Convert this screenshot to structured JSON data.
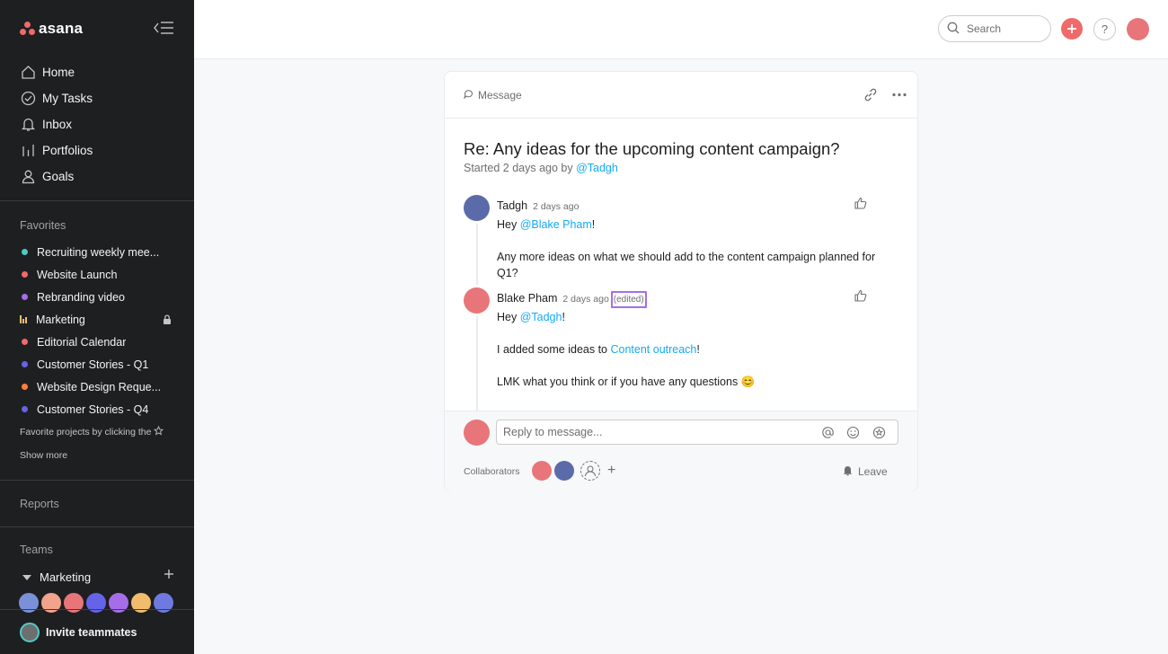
{
  "sidebar": {
    "logo_text": "asana",
    "nav": [
      {
        "label": "Home",
        "icon": "home-icon"
      },
      {
        "label": "My Tasks",
        "icon": "check-circle-icon"
      },
      {
        "label": "Inbox",
        "icon": "bell-icon"
      },
      {
        "label": "Portfolios",
        "icon": "bar-chart-icon"
      },
      {
        "label": "Goals",
        "icon": "person-icon"
      }
    ],
    "favorites_title": "Favorites",
    "favorites": [
      {
        "label": "Recruiting weekly mee...",
        "color": "#4ecbc4"
      },
      {
        "label": "Website Launch",
        "color": "#f06a6a"
      },
      {
        "label": "Rebranding video",
        "color": "#a56ee8"
      },
      {
        "label": "Marketing",
        "color": "#f1bd6c",
        "icon": "bars-icon",
        "locked": true
      },
      {
        "label": "Editorial Calendar",
        "color": "#f06a6a"
      },
      {
        "label": "Customer Stories - Q1",
        "color": "#6563e8"
      },
      {
        "label": "Website Design Reque...",
        "color": "#fd7f3a"
      },
      {
        "label": "Customer Stories - Q4",
        "color": "#6563e8"
      }
    ],
    "favorites_hint": "Favorite projects by clicking the",
    "show_more": "Show more",
    "reports_title": "Reports",
    "teams_title": "Teams",
    "team_name": "Marketing",
    "invite_label": "Invite teammates"
  },
  "topbar": {
    "search_placeholder": "Search",
    "help_label": "?"
  },
  "message": {
    "type_label": "Message",
    "title": "Re: Any ideas for the upcoming content campaign?",
    "subtitle_prefix": "Started 2 days ago by ",
    "subtitle_mention": "@Tadgh",
    "comments": [
      {
        "author": "Tadgh",
        "time": "2 days ago",
        "greeting": "Hey ",
        "greeting_mention": "@Blake Pham",
        "greeting_suffix": "!",
        "body": "Any more ideas on what we should add to the content campaign planned for Q1?"
      },
      {
        "author": "Blake Pham",
        "time": "2 days ago",
        "edited": "(edited)",
        "greeting": "Hey ",
        "greeting_mention": "@Tadgh",
        "greeting_suffix": "!",
        "line2_prefix": "I added some ideas to ",
        "line2_link": "Content outreach",
        "line2_suffix": "!",
        "line3": "LMK what you think  or if you have any questions 😊"
      }
    ],
    "reply_placeholder": "Reply to message...",
    "collaborators_label": "Collaborators",
    "collab_plus": "+",
    "leave_label": "Leave"
  }
}
